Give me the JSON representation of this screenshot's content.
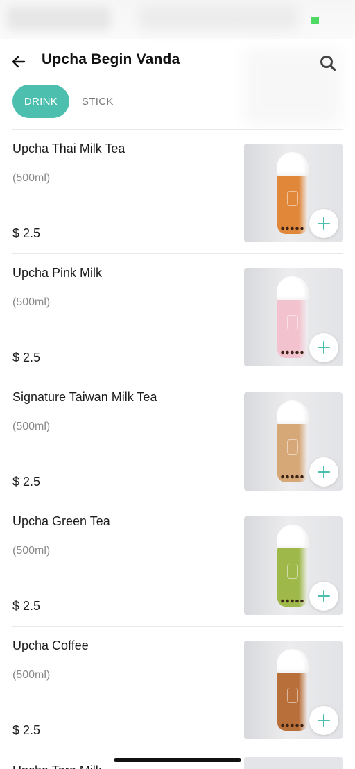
{
  "status": {
    "battery_color": "#4cd964"
  },
  "header": {
    "title": "Upcha Begin Vanda",
    "back_icon": "arrow-left-icon",
    "search_icon": "search-icon"
  },
  "tabs": [
    {
      "label": "DRINK",
      "active": true
    },
    {
      "label": "STICK",
      "active": false
    }
  ],
  "colors": {
    "accent": "#4dbfae"
  },
  "items": [
    {
      "name": "Upcha Thai Milk Tea",
      "size": "(500ml)",
      "price": "$ 2.5",
      "drink_color": "#e0873a"
    },
    {
      "name": "Upcha Pink Milk",
      "size": "(500ml)",
      "price": "$ 2.5",
      "drink_color": "#f2c3cf"
    },
    {
      "name": "Signature Taiwan Milk Tea",
      "size": "(500ml)",
      "price": "$ 2.5",
      "drink_color": "#d6a777"
    },
    {
      "name": "Upcha Green Tea",
      "size": "(500ml)",
      "price": "$ 2.5",
      "drink_color": "#9fb84a"
    },
    {
      "name": "Upcha Coffee",
      "size": "(500ml)",
      "price": "$ 2.5",
      "drink_color": "#b86f3a"
    }
  ],
  "partial_item": {
    "name": "Upcha Taro Milk"
  }
}
